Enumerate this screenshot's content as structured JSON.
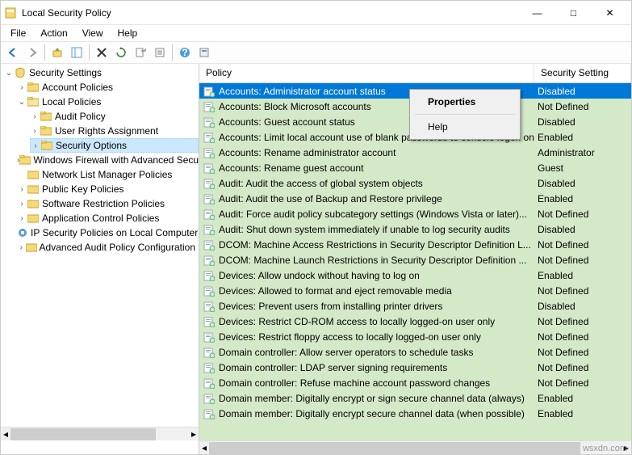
{
  "window": {
    "title": "Local Security Policy",
    "btn_min": "—",
    "btn_max": "□",
    "btn_close": "✕"
  },
  "menu": {
    "file": "File",
    "action": "Action",
    "view": "View",
    "help": "Help"
  },
  "tree": {
    "root": "Security Settings",
    "account_policies": "Account Policies",
    "local_policies": "Local Policies",
    "audit_policy": "Audit Policy",
    "user_rights": "User Rights Assignment",
    "security_options": "Security Options",
    "firewall": "Windows Firewall with Advanced Security",
    "network_list": "Network List Manager Policies",
    "public_key": "Public Key Policies",
    "software_restriction": "Software Restriction Policies",
    "app_control": "Application Control Policies",
    "ip_security": "IP Security Policies on Local Computer",
    "advanced_audit": "Advanced Audit Policy Configuration"
  },
  "list": {
    "header_policy": "Policy",
    "header_setting": "Security Setting"
  },
  "policies": [
    {
      "name": "Accounts: Administrator account status",
      "value": "Disabled",
      "sel": true
    },
    {
      "name": "Accounts: Block Microsoft accounts",
      "value": "Not Defined"
    },
    {
      "name": "Accounts: Guest account status",
      "value": "Disabled"
    },
    {
      "name": "Accounts: Limit local account use of blank passwords to console logon only",
      "value": "Enabled"
    },
    {
      "name": "Accounts: Rename administrator account",
      "value": "Administrator"
    },
    {
      "name": "Accounts: Rename guest account",
      "value": "Guest"
    },
    {
      "name": "Audit: Audit the access of global system objects",
      "value": "Disabled"
    },
    {
      "name": "Audit: Audit the use of Backup and Restore privilege",
      "value": "Enabled"
    },
    {
      "name": "Audit: Force audit policy subcategory settings (Windows Vista or later)...",
      "value": "Not Defined"
    },
    {
      "name": "Audit: Shut down system immediately if unable to log security audits",
      "value": "Disabled"
    },
    {
      "name": "DCOM: Machine Access Restrictions in Security Descriptor Definition L...",
      "value": "Not Defined"
    },
    {
      "name": "DCOM: Machine Launch Restrictions in Security Descriptor Definition ...",
      "value": "Not Defined"
    },
    {
      "name": "Devices: Allow undock without having to log on",
      "value": "Enabled"
    },
    {
      "name": "Devices: Allowed to format and eject removable media",
      "value": "Not Defined"
    },
    {
      "name": "Devices: Prevent users from installing printer drivers",
      "value": "Disabled"
    },
    {
      "name": "Devices: Restrict CD-ROM access to locally logged-on user only",
      "value": "Not Defined"
    },
    {
      "name": "Devices: Restrict floppy access to locally logged-on user only",
      "value": "Not Defined"
    },
    {
      "name": "Domain controller: Allow server operators to schedule tasks",
      "value": "Not Defined"
    },
    {
      "name": "Domain controller: LDAP server signing requirements",
      "value": "Not Defined"
    },
    {
      "name": "Domain controller: Refuse machine account password changes",
      "value": "Not Defined"
    },
    {
      "name": "Domain member: Digitally encrypt or sign secure channel data (always)",
      "value": "Enabled"
    },
    {
      "name": "Domain member: Digitally encrypt secure channel data (when possible)",
      "value": "Enabled"
    }
  ],
  "context_menu": {
    "properties": "Properties",
    "help": "Help"
  },
  "watermark": "wsxdn.com"
}
